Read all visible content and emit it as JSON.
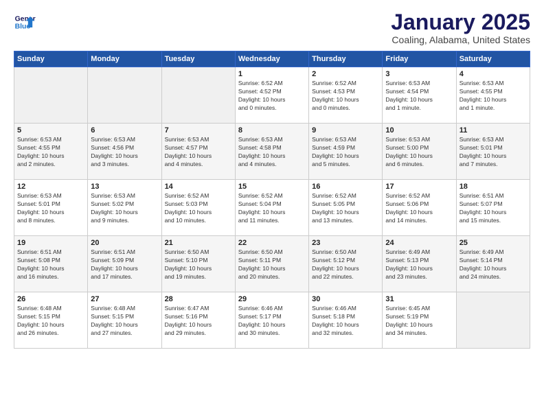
{
  "header": {
    "logo_line1": "General",
    "logo_line2": "Blue",
    "main_title": "January 2025",
    "sub_title": "Coaling, Alabama, United States"
  },
  "days_of_week": [
    "Sunday",
    "Monday",
    "Tuesday",
    "Wednesday",
    "Thursday",
    "Friday",
    "Saturday"
  ],
  "weeks": [
    [
      {
        "day": "",
        "info": ""
      },
      {
        "day": "",
        "info": ""
      },
      {
        "day": "",
        "info": ""
      },
      {
        "day": "1",
        "info": "Sunrise: 6:52 AM\nSunset: 4:52 PM\nDaylight: 10 hours\nand 0 minutes."
      },
      {
        "day": "2",
        "info": "Sunrise: 6:52 AM\nSunset: 4:53 PM\nDaylight: 10 hours\nand 0 minutes."
      },
      {
        "day": "3",
        "info": "Sunrise: 6:53 AM\nSunset: 4:54 PM\nDaylight: 10 hours\nand 1 minute."
      },
      {
        "day": "4",
        "info": "Sunrise: 6:53 AM\nSunset: 4:55 PM\nDaylight: 10 hours\nand 1 minute."
      }
    ],
    [
      {
        "day": "5",
        "info": "Sunrise: 6:53 AM\nSunset: 4:55 PM\nDaylight: 10 hours\nand 2 minutes."
      },
      {
        "day": "6",
        "info": "Sunrise: 6:53 AM\nSunset: 4:56 PM\nDaylight: 10 hours\nand 3 minutes."
      },
      {
        "day": "7",
        "info": "Sunrise: 6:53 AM\nSunset: 4:57 PM\nDaylight: 10 hours\nand 4 minutes."
      },
      {
        "day": "8",
        "info": "Sunrise: 6:53 AM\nSunset: 4:58 PM\nDaylight: 10 hours\nand 4 minutes."
      },
      {
        "day": "9",
        "info": "Sunrise: 6:53 AM\nSunset: 4:59 PM\nDaylight: 10 hours\nand 5 minutes."
      },
      {
        "day": "10",
        "info": "Sunrise: 6:53 AM\nSunset: 5:00 PM\nDaylight: 10 hours\nand 6 minutes."
      },
      {
        "day": "11",
        "info": "Sunrise: 6:53 AM\nSunset: 5:01 PM\nDaylight: 10 hours\nand 7 minutes."
      }
    ],
    [
      {
        "day": "12",
        "info": "Sunrise: 6:53 AM\nSunset: 5:01 PM\nDaylight: 10 hours\nand 8 minutes."
      },
      {
        "day": "13",
        "info": "Sunrise: 6:53 AM\nSunset: 5:02 PM\nDaylight: 10 hours\nand 9 minutes."
      },
      {
        "day": "14",
        "info": "Sunrise: 6:52 AM\nSunset: 5:03 PM\nDaylight: 10 hours\nand 10 minutes."
      },
      {
        "day": "15",
        "info": "Sunrise: 6:52 AM\nSunset: 5:04 PM\nDaylight: 10 hours\nand 11 minutes."
      },
      {
        "day": "16",
        "info": "Sunrise: 6:52 AM\nSunset: 5:05 PM\nDaylight: 10 hours\nand 13 minutes."
      },
      {
        "day": "17",
        "info": "Sunrise: 6:52 AM\nSunset: 5:06 PM\nDaylight: 10 hours\nand 14 minutes."
      },
      {
        "day": "18",
        "info": "Sunrise: 6:51 AM\nSunset: 5:07 PM\nDaylight: 10 hours\nand 15 minutes."
      }
    ],
    [
      {
        "day": "19",
        "info": "Sunrise: 6:51 AM\nSunset: 5:08 PM\nDaylight: 10 hours\nand 16 minutes."
      },
      {
        "day": "20",
        "info": "Sunrise: 6:51 AM\nSunset: 5:09 PM\nDaylight: 10 hours\nand 17 minutes."
      },
      {
        "day": "21",
        "info": "Sunrise: 6:50 AM\nSunset: 5:10 PM\nDaylight: 10 hours\nand 19 minutes."
      },
      {
        "day": "22",
        "info": "Sunrise: 6:50 AM\nSunset: 5:11 PM\nDaylight: 10 hours\nand 20 minutes."
      },
      {
        "day": "23",
        "info": "Sunrise: 6:50 AM\nSunset: 5:12 PM\nDaylight: 10 hours\nand 22 minutes."
      },
      {
        "day": "24",
        "info": "Sunrise: 6:49 AM\nSunset: 5:13 PM\nDaylight: 10 hours\nand 23 minutes."
      },
      {
        "day": "25",
        "info": "Sunrise: 6:49 AM\nSunset: 5:14 PM\nDaylight: 10 hours\nand 24 minutes."
      }
    ],
    [
      {
        "day": "26",
        "info": "Sunrise: 6:48 AM\nSunset: 5:15 PM\nDaylight: 10 hours\nand 26 minutes."
      },
      {
        "day": "27",
        "info": "Sunrise: 6:48 AM\nSunset: 5:15 PM\nDaylight: 10 hours\nand 27 minutes."
      },
      {
        "day": "28",
        "info": "Sunrise: 6:47 AM\nSunset: 5:16 PM\nDaylight: 10 hours\nand 29 minutes."
      },
      {
        "day": "29",
        "info": "Sunrise: 6:46 AM\nSunset: 5:17 PM\nDaylight: 10 hours\nand 30 minutes."
      },
      {
        "day": "30",
        "info": "Sunrise: 6:46 AM\nSunset: 5:18 PM\nDaylight: 10 hours\nand 32 minutes."
      },
      {
        "day": "31",
        "info": "Sunrise: 6:45 AM\nSunset: 5:19 PM\nDaylight: 10 hours\nand 34 minutes."
      },
      {
        "day": "",
        "info": ""
      }
    ]
  ]
}
